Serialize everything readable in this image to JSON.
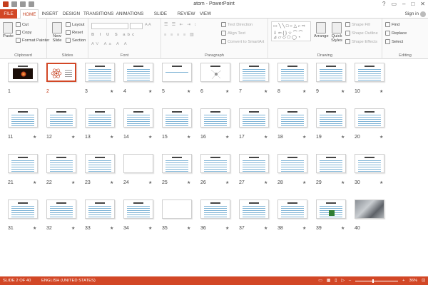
{
  "window": {
    "title": "atom - PowerPoint",
    "signin": "Sign in"
  },
  "tabs": [
    "FILE",
    "HOME",
    "INSERT",
    "DESIGN",
    "TRANSITIONS",
    "ANIMATIONS",
    "SLIDE SHOW",
    "REVIEW",
    "VIEW"
  ],
  "ribbon": {
    "clipboard": {
      "paste": "Paste",
      "cut": "Cut",
      "copy": "Copy",
      "format_painter": "Format Painter",
      "label": "Clipboard"
    },
    "slides": {
      "new_slide": "New Slide",
      "layout": "Layout",
      "reset": "Reset",
      "section": "Section",
      "label": "Slides"
    },
    "font": {
      "size_placeholder": "",
      "label": "Font"
    },
    "paragraph": {
      "text_direction": "Text Direction",
      "align_text": "Align Text",
      "convert_smartart": "Convert to SmartArt",
      "label": "Paragraph"
    },
    "drawing": {
      "arrange": "Arrange",
      "quick_styles": "Quick Styles",
      "shape_fill": "Shape Fill",
      "shape_outline": "Shape Outline",
      "shape_effects": "Shape Effects",
      "label": "Drawing"
    },
    "editing": {
      "find": "Find",
      "replace": "Replace",
      "select": "Select",
      "label": "Editing"
    }
  },
  "accent_color": "#d24726",
  "slides": [
    {
      "n": "1",
      "star": false,
      "kind": "dark"
    },
    {
      "n": "2",
      "star": false,
      "kind": "atom",
      "selected": true
    },
    {
      "n": "3",
      "star": true,
      "kind": "text"
    },
    {
      "n": "4",
      "star": true,
      "kind": "text"
    },
    {
      "n": "5",
      "star": true,
      "kind": "sparse"
    },
    {
      "n": "6",
      "star": true,
      "kind": "diagram"
    },
    {
      "n": "7",
      "star": true,
      "kind": "text"
    },
    {
      "n": "8",
      "star": true,
      "kind": "text"
    },
    {
      "n": "9",
      "star": true,
      "kind": "text"
    },
    {
      "n": "10",
      "star": true,
      "kind": "text"
    },
    {
      "n": "11",
      "star": true,
      "kind": "text"
    },
    {
      "n": "12",
      "star": true,
      "kind": "text"
    },
    {
      "n": "13",
      "star": true,
      "kind": "text"
    },
    {
      "n": "14",
      "star": true,
      "kind": "text"
    },
    {
      "n": "15",
      "star": true,
      "kind": "text"
    },
    {
      "n": "16",
      "star": true,
      "kind": "text"
    },
    {
      "n": "17",
      "star": true,
      "kind": "text"
    },
    {
      "n": "18",
      "star": true,
      "kind": "text"
    },
    {
      "n": "19",
      "star": true,
      "kind": "text"
    },
    {
      "n": "20",
      "star": true,
      "kind": "text"
    },
    {
      "n": "21",
      "star": true,
      "kind": "text"
    },
    {
      "n": "22",
      "star": true,
      "kind": "text"
    },
    {
      "n": "23",
      "star": true,
      "kind": "text"
    },
    {
      "n": "24",
      "star": true,
      "kind": "blank"
    },
    {
      "n": "25",
      "star": true,
      "kind": "text"
    },
    {
      "n": "26",
      "star": true,
      "kind": "text"
    },
    {
      "n": "27",
      "star": true,
      "kind": "text"
    },
    {
      "n": "28",
      "star": true,
      "kind": "text"
    },
    {
      "n": "29",
      "star": true,
      "kind": "text"
    },
    {
      "n": "30",
      "star": true,
      "kind": "text"
    },
    {
      "n": "31",
      "star": true,
      "kind": "text"
    },
    {
      "n": "32",
      "star": true,
      "kind": "text"
    },
    {
      "n": "33",
      "star": true,
      "kind": "text"
    },
    {
      "n": "34",
      "star": true,
      "kind": "text"
    },
    {
      "n": "35",
      "star": true,
      "kind": "blank"
    },
    {
      "n": "36",
      "star": true,
      "kind": "text"
    },
    {
      "n": "37",
      "star": true,
      "kind": "text"
    },
    {
      "n": "38",
      "star": true,
      "kind": "text"
    },
    {
      "n": "39",
      "star": true,
      "kind": "green"
    },
    {
      "n": "40",
      "star": false,
      "kind": "photo"
    }
  ],
  "status": {
    "slide_of": "SLIDE 2 OF 40",
    "language": "ENGLISH (UNITED STATES)",
    "zoom": "36%"
  }
}
